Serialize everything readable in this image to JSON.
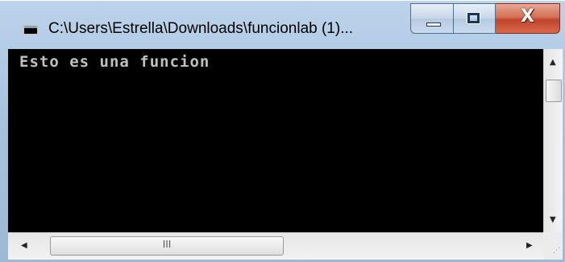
{
  "window": {
    "title": "C:\\Users\\Estrella\\Downloads\\funcionlab (1)...",
    "icon": "console-window-icon",
    "buttons": {
      "minimize_icon": "minimize-icon",
      "maximize_icon": "maximize-icon",
      "close_glyph": "X"
    }
  },
  "console": {
    "output": "Esto es una funcion",
    "background": "#000000",
    "text_color": "#c0c0c0"
  },
  "scrollbar": {
    "horizontal_grip": "III",
    "arrows": {
      "up": "▲",
      "down": "▼",
      "left": "◀",
      "right": "▶"
    }
  },
  "colors": {
    "title_bar": "#a7c2df",
    "close_button": "#c2442b"
  }
}
